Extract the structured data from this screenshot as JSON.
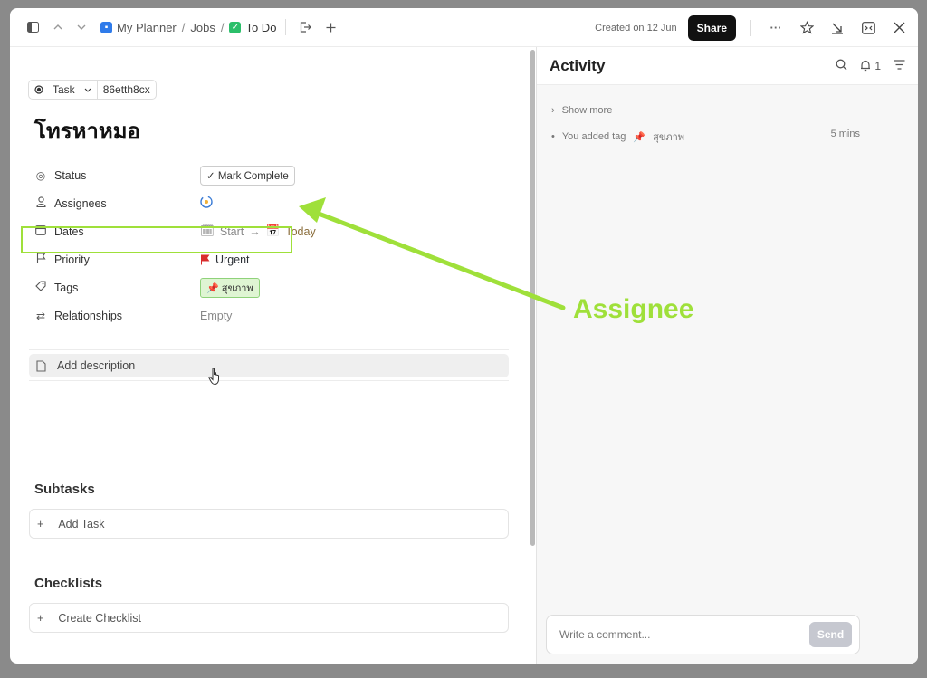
{
  "topbar": {
    "breadcrumb": [
      "My Planner",
      "Jobs",
      "To Do"
    ],
    "sep": "/",
    "created": "Created on 12 Jun",
    "share": "Share",
    "more": "···"
  },
  "task": {
    "type": "Task",
    "id": "86etth8cx",
    "title": "โทรหาหมอ",
    "fields": {
      "status_label": "Status",
      "status_value": "Mark Complete",
      "assignees_label": "Assignees",
      "dates_label": "Dates",
      "dates_start": "Start",
      "dates_arrow": "→",
      "dates_end": "Today",
      "priority_label": "Priority",
      "priority_value": "Urgent",
      "tags_label": "Tags",
      "tags_value": "สุขภาพ",
      "relationships_label": "Relationships",
      "relationships_value": "Empty"
    },
    "add_description": "Add description",
    "subtasks_title": "Subtasks",
    "add_task": "Add Task",
    "checklists_title": "Checklists",
    "create_checklist": "Create Checklist",
    "plus": "+"
  },
  "activity": {
    "title": "Activity",
    "notifications": "1",
    "show_more": "Show more",
    "event": "You added tag",
    "event_tag": "สุขภาพ",
    "event_time": "5 mins",
    "comment_placeholder": "Write a comment...",
    "send": "Send"
  },
  "annotation": {
    "label": "Assignee",
    "color": "#9fe03a"
  },
  "colors": {
    "share_bg": "#111111",
    "planner_icon": "#2f7bea",
    "todo_icon": "#2bbf6a",
    "urgent_flag": "#d92d2d",
    "tag_bg": "#dff5d3"
  }
}
